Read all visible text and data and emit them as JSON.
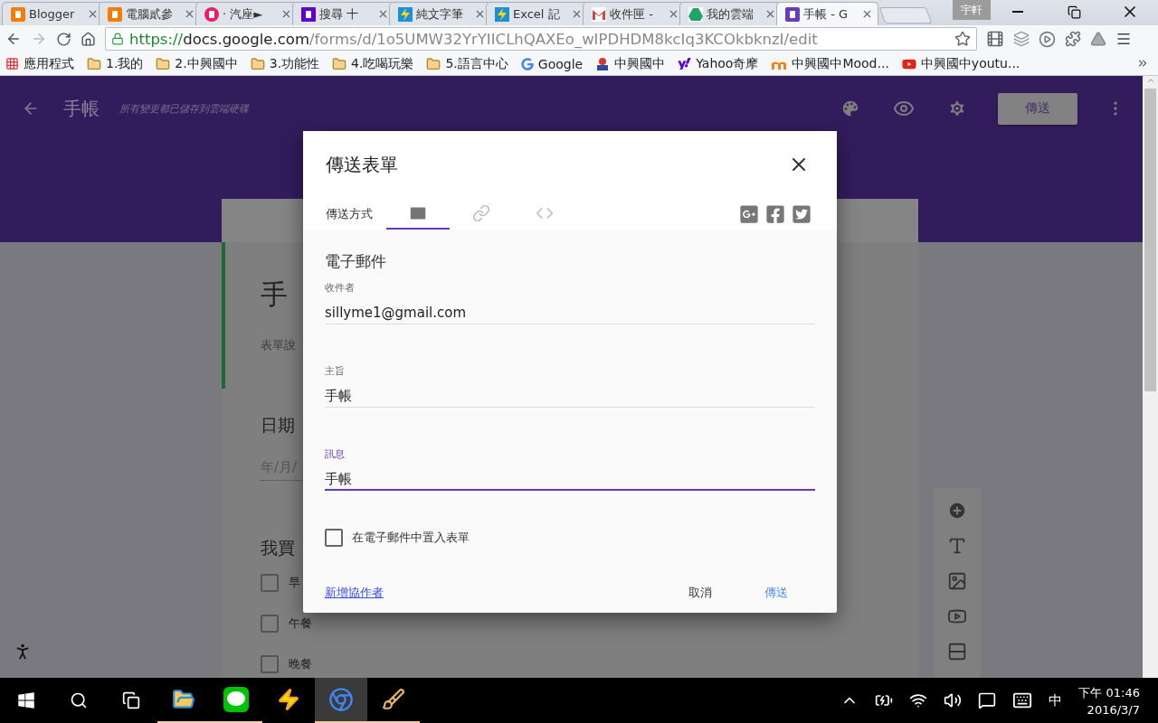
{
  "browser": {
    "tabs": [
      {
        "title": "Blogger",
        "kind": "blogger",
        "selected": false
      },
      {
        "title": "電腦貳參",
        "kind": "blogger",
        "selected": false
      },
      {
        "title": "· 汽座►",
        "kind": "alert",
        "selected": false
      },
      {
        "title": "搜尋 十",
        "kind": "yahoo",
        "selected": false
      },
      {
        "title": "純文字筆",
        "kind": "bolt",
        "selected": false
      },
      {
        "title": "Excel 記",
        "kind": "bolt",
        "selected": false
      },
      {
        "title": "收件匣 -",
        "kind": "gmail",
        "selected": false
      },
      {
        "title": "我的雲端",
        "kind": "drive",
        "selected": false
      },
      {
        "title": "手帳 - G",
        "kind": "forms",
        "selected": true
      }
    ],
    "profile": "宇軒",
    "url": {
      "scheme": "https://",
      "host": "docs.google.com",
      "path": "/forms/d/1o5UMW32YrYIICLhQAXEo_wIPDHDM8kcIq3KCOkbknzI/edit"
    },
    "bookmarks": [
      {
        "label": "應用程式",
        "kind": "apps"
      },
      {
        "label": "1.我的",
        "kind": "folder"
      },
      {
        "label": "2.中興國中",
        "kind": "folder"
      },
      {
        "label": "3.功能性",
        "kind": "folder"
      },
      {
        "label": "4.吃喝玩樂",
        "kind": "folder"
      },
      {
        "label": "5.語言中心",
        "kind": "folder"
      },
      {
        "label": "Google",
        "kind": "google"
      },
      {
        "label": "中興國中",
        "kind": "school"
      },
      {
        "label": "Yahoo奇摩",
        "kind": "yahoo"
      },
      {
        "label": "中興國中Mood...",
        "kind": "moodle"
      },
      {
        "label": "中興國中youtu...",
        "kind": "youtube"
      }
    ]
  },
  "form_header": {
    "title": "手帳",
    "save_status": "所有變更都已儲存到雲端硬碟",
    "send_button": "傳送"
  },
  "form": {
    "title": "手",
    "description": "表單說",
    "questions": [
      {
        "title": "日期",
        "kind": "date",
        "placeholder": "年/月/"
      },
      {
        "title": "我買",
        "kind": "checkboxes",
        "options": [
          {
            "label": "早",
            "checked": false
          },
          {
            "label": "午餐",
            "checked": false
          },
          {
            "label": "晚餐",
            "checked": false
          }
        ]
      }
    ]
  },
  "dialog": {
    "title": "傳送表單",
    "method_label": "傳送方式",
    "methods": [
      {
        "kind": "email",
        "selected": true
      },
      {
        "kind": "link",
        "selected": false
      },
      {
        "kind": "embed",
        "selected": false
      }
    ],
    "section_title": "電子郵件",
    "fields": [
      {
        "label": "收件者",
        "value": "sillyme1@gmail.com",
        "focused": false
      },
      {
        "label": "主旨",
        "value": "手帳",
        "focused": false
      },
      {
        "label": "訊息",
        "value": "手帳",
        "focused": true
      }
    ],
    "include_form": {
      "label": "在電子郵件中置入表單",
      "checked": false
    },
    "add_collaborators": "新增協作者",
    "cancel": "取消",
    "send": "傳送"
  },
  "taskbar": {
    "apps": [
      {
        "kind": "explorer",
        "running": true,
        "selected": false
      },
      {
        "kind": "line",
        "running": true,
        "selected": false
      },
      {
        "kind": "bolt",
        "running": false,
        "selected": false
      },
      {
        "kind": "chrome",
        "running": true,
        "selected": true
      },
      {
        "kind": "paint",
        "running": true,
        "selected": false
      }
    ],
    "ime": "中",
    "time": "下午 01:46",
    "date": "2016/3/7"
  }
}
